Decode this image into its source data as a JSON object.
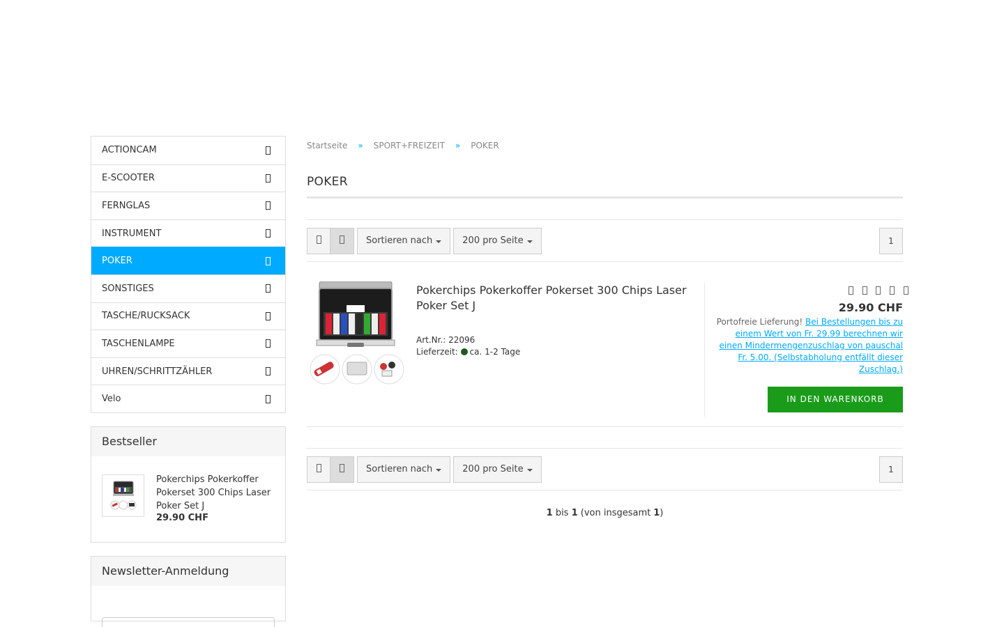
{
  "categories": [
    {
      "label": "ACTIONCAM",
      "active": false
    },
    {
      "label": "E-SCOOTER",
      "active": false
    },
    {
      "label": "FERNGLAS",
      "active": false
    },
    {
      "label": "INSTRUMENT",
      "active": false
    },
    {
      "label": "POKER",
      "active": true
    },
    {
      "label": "SONSTIGES",
      "active": false
    },
    {
      "label": "TASCHE/RUCKSACK",
      "active": false
    },
    {
      "label": "TASCHENLAMPE",
      "active": false
    },
    {
      "label": "UHREN/SCHRITTZÄHLER",
      "active": false
    },
    {
      "label": "Velo",
      "active": false
    }
  ],
  "bestseller": {
    "title": "Bestseller",
    "product_name": "Pokerchips Pokerkoffer Pokerset 300 Chips Laser Poker Set J",
    "price": "29.90 CHF"
  },
  "newsletter": {
    "title": "Newsletter-Anmeldung"
  },
  "breadcrumb": {
    "home": "Startseite",
    "sep": "»",
    "level1": "SPORT+FREIZEIT",
    "level2": "POKER"
  },
  "page_title": "POKER",
  "toolbar": {
    "sort_label": "Sortieren nach",
    "per_page_label": "200 pro Seite",
    "page": "1",
    "grid_icon": "grid-view-icon",
    "list_icon": "list-view-icon"
  },
  "product": {
    "name": "Pokerchips Pokerkoffer Pokerset 300 Chips Laser Poker Set J",
    "art_label": "Art.Nr.: 22096",
    "delivery_label": "Lieferzeit:",
    "delivery_value": "ca. 1-2 Tage",
    "rating_stars": 0,
    "price": "29.90 CHF",
    "shipping_prefix": "Portofreie Lieferung!",
    "shipping_link": "Bei Bestellungen bis zu einem Wert von Fr. 29.99 berechnen wir einen Mindermengenzuschlag von pauschal Fr. 5.00. (Selbstabholung entfällt dieser Zuschlag.)",
    "cart_button": "IN DEN WARENKORB"
  },
  "results": {
    "from": "1",
    "bis": "bis",
    "to": "1",
    "prefix": "(von insgesamt",
    "total": "1",
    "suffix": ")"
  },
  "colors": {
    "accent": "#00aaff",
    "cart_green": "#1a9c1a",
    "available": "#1e5c1e"
  }
}
